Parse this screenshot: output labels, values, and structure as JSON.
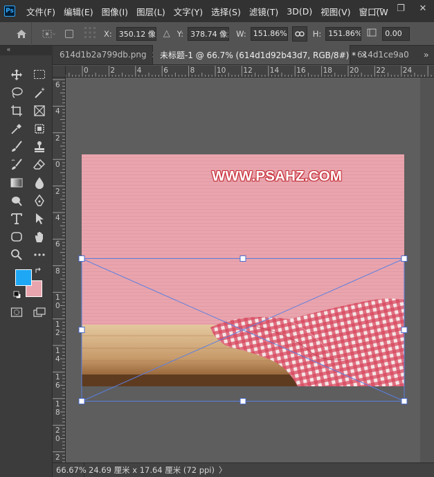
{
  "menubar": {
    "app_icon": "Ps",
    "items": [
      "文件(F)",
      "编辑(E)",
      "图像(I)",
      "图层(L)",
      "文字(Y)",
      "选择(S)",
      "滤镜(T)",
      "3D(D)",
      "视图(V)",
      "窗口(W"
    ],
    "window_controls": [
      "—",
      "❐",
      "✕"
    ]
  },
  "options": {
    "x_label": "X:",
    "x_value": "350.12 像素",
    "y_label": "Y:",
    "y_value": "378.74 像素",
    "w_label": "W:",
    "w_value": "151.86%",
    "h_label": "H:",
    "h_value": "151.86%",
    "angle_value": "0.00"
  },
  "tabs": [
    {
      "label": "614d1b2a799db.png",
      "close": "×",
      "active": false
    },
    {
      "label": "未标题-1 @ 66.7% (614d1d92b43d7, RGB/8#) *",
      "close": "×",
      "active": true
    },
    {
      "label": "614d1ce9a0",
      "close": "",
      "active": false
    }
  ],
  "tabs_more": "»",
  "toolbar": {
    "collapse": "«",
    "fg_color": "#1ea7f4",
    "bg_color": "#e8a5ae",
    "tools": [
      "move-tool",
      "marquee-tool",
      "lasso-tool",
      "magic-wand-tool",
      "crop-tool",
      "frame-tool",
      "eyedropper-tool",
      "patch-tool",
      "brush-tool",
      "stamp-tool",
      "history-brush-tool",
      "eraser-tool",
      "gradient-tool",
      "blur-tool",
      "dodge-tool",
      "pen-tool",
      "type-tool",
      "path-select-tool",
      "shape-tool",
      "hand-tool",
      "zoom-tool",
      "more-tools",
      "quick-mask",
      "screen-mode"
    ]
  },
  "ruler_top": [
    "0",
    "2",
    "4",
    "6",
    "8",
    "10",
    "12",
    "14",
    "16",
    "18",
    "20",
    "22",
    "24"
  ],
  "ruler_left": [
    "6",
    "4",
    "2",
    "0",
    "2",
    "4",
    "6",
    "8",
    "1 0",
    "1 2",
    "1 4",
    "1 6",
    "1 8",
    "2 0",
    "2 2"
  ],
  "canvas": {
    "watermark": "WWW.PSAHZ.COM",
    "background_color": "#e9a4ad",
    "table_color": "#c79a6a",
    "cloth_color": "#c8324a"
  },
  "status": {
    "zoom": "66.67%",
    "doc_info": "24.69 厘米 x 17.64 厘米 (72 ppi)",
    "arrow": "〉"
  }
}
